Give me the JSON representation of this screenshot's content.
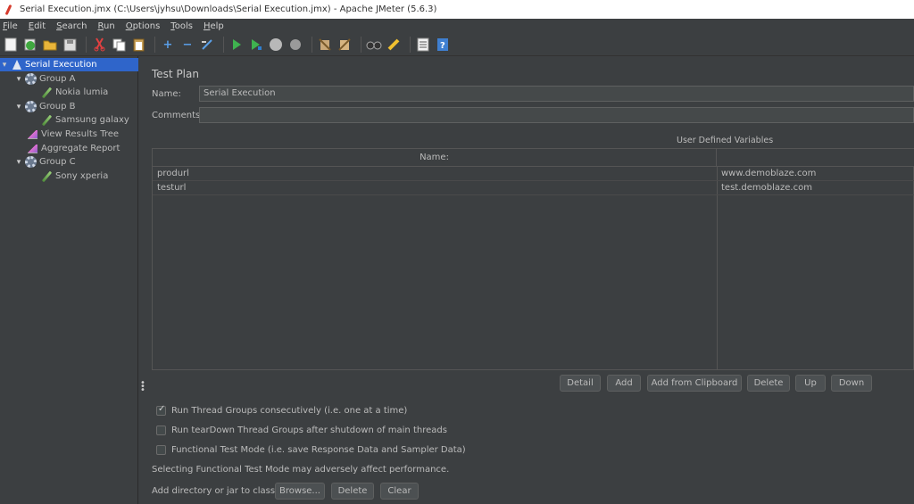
{
  "window": {
    "title": "Serial Execution.jmx (C:\\Users\\jyhsu\\Downloads\\Serial Execution.jmx) - Apache JMeter (5.6.3)"
  },
  "menu": [
    "File",
    "Edit",
    "Search",
    "Run",
    "Options",
    "Tools",
    "Help"
  ],
  "tree": {
    "items": [
      {
        "label": "Serial Execution",
        "icon": "test-plan-icon"
      },
      {
        "label": "Group A",
        "icon": "thread-group-icon"
      },
      {
        "label": "Nokia lumia",
        "icon": "sampler-icon"
      },
      {
        "label": "Group B",
        "icon": "thread-group-icon"
      },
      {
        "label": "Samsung galaxy",
        "icon": "sampler-icon"
      },
      {
        "label": "View Results Tree",
        "icon": "listener-icon"
      },
      {
        "label": "Aggregate Report",
        "icon": "listener-icon"
      },
      {
        "label": "Group C",
        "icon": "thread-group-icon"
      },
      {
        "label": "Sony xperia",
        "icon": "sampler-icon"
      }
    ]
  },
  "main": {
    "title": "Test Plan",
    "name_label": "Name:",
    "name_value": "Serial Execution",
    "comments_label": "Comments:",
    "comments_value": "",
    "udv_title": "User Defined Variables",
    "udv_header_name": "Name:",
    "udv_rows": [
      {
        "name": "produrl",
        "value": "www.demoblaze.com"
      },
      {
        "name": "testurl",
        "value": "test.demoblaze.com"
      }
    ],
    "buttons": {
      "detail": "Detail",
      "add": "Add",
      "add_clipboard": "Add from Clipboard",
      "delete": "Delete",
      "up": "Up",
      "down": "Down"
    },
    "options": {
      "run_consecutively": "Run Thread Groups consecutively (i.e. one at a time)",
      "run_teardown": "Run tearDown Thread Groups after shutdown of main threads",
      "functional_mode": "Functional Test Mode (i.e. save Response Data and Sampler Data)",
      "functional_note": "Selecting Functional Test Mode may adversely affect performance."
    },
    "classpath": {
      "label": "Add directory or jar to classpath",
      "browse": "Browse...",
      "delete": "Delete",
      "clear": "Clear"
    }
  }
}
